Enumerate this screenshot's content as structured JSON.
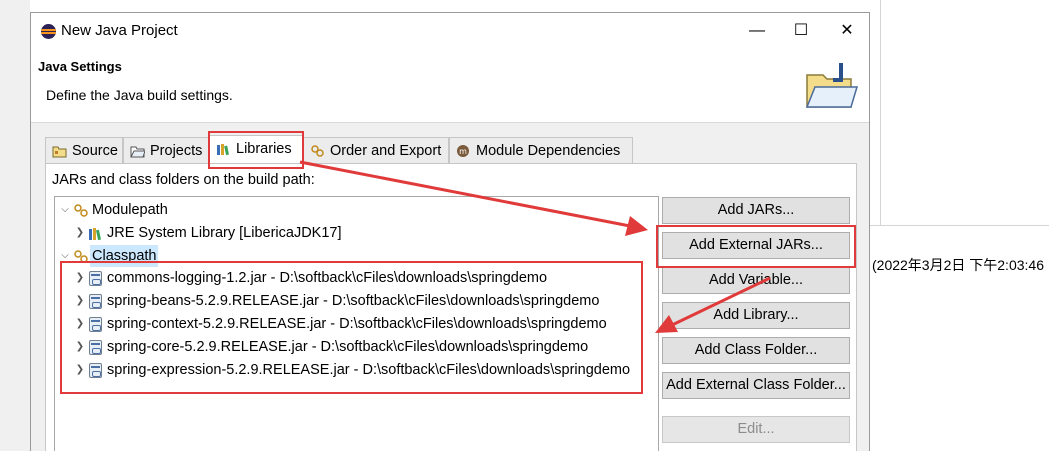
{
  "window": {
    "title": "New Java Project",
    "minimize_icon": "minimize-icon",
    "maximize_icon": "maximize-icon",
    "close_icon": "close-icon"
  },
  "header": {
    "title": "Java Settings",
    "description": "Define the Java build settings."
  },
  "tabs": [
    {
      "label": "Source",
      "icon": "source-folder-icon"
    },
    {
      "label": "Projects",
      "icon": "projects-folder-icon"
    },
    {
      "label": "Libraries",
      "icon": "libraries-icon",
      "active": true
    },
    {
      "label": "Order and Export",
      "icon": "order-export-icon"
    },
    {
      "label": "Module Dependencies",
      "icon": "module-dependencies-icon"
    }
  ],
  "panel": {
    "label": "JARs and class folders on the build path:"
  },
  "tree": {
    "modulepath": {
      "label": "Modulepath",
      "expanded": true
    },
    "jre": {
      "label": "JRE System Library [LibericaJDK17]"
    },
    "classpath": {
      "label": "Classpath",
      "expanded": true,
      "selected": true
    },
    "jars": [
      "commons-logging-1.2.jar - D:\\softback\\cFiles\\downloads\\springdemo",
      "spring-beans-5.2.9.RELEASE.jar - D:\\softback\\cFiles\\downloads\\springdemo",
      "spring-context-5.2.9.RELEASE.jar - D:\\softback\\cFiles\\downloads\\springdemo",
      "spring-core-5.2.9.RELEASE.jar - D:\\softback\\cFiles\\downloads\\springdemo",
      "spring-expression-5.2.9.RELEASE.jar - D:\\softback\\cFiles\\downloads\\springdemo"
    ]
  },
  "buttons": {
    "add_jars": "Add JARs...",
    "add_external_jars": "Add External JARs...",
    "add_variable": "Add Variable...",
    "add_library": "Add Library...",
    "add_class_folder": "Add Class Folder...",
    "add_external_class_folder": "Add External Class Folder...",
    "edit": "Edit..."
  },
  "background": {
    "timestamp": "(2022年3月2日 下午2:03:46"
  },
  "colors": {
    "annotation_red": "#e03a3a",
    "selection_blue": "#cce8ff"
  }
}
